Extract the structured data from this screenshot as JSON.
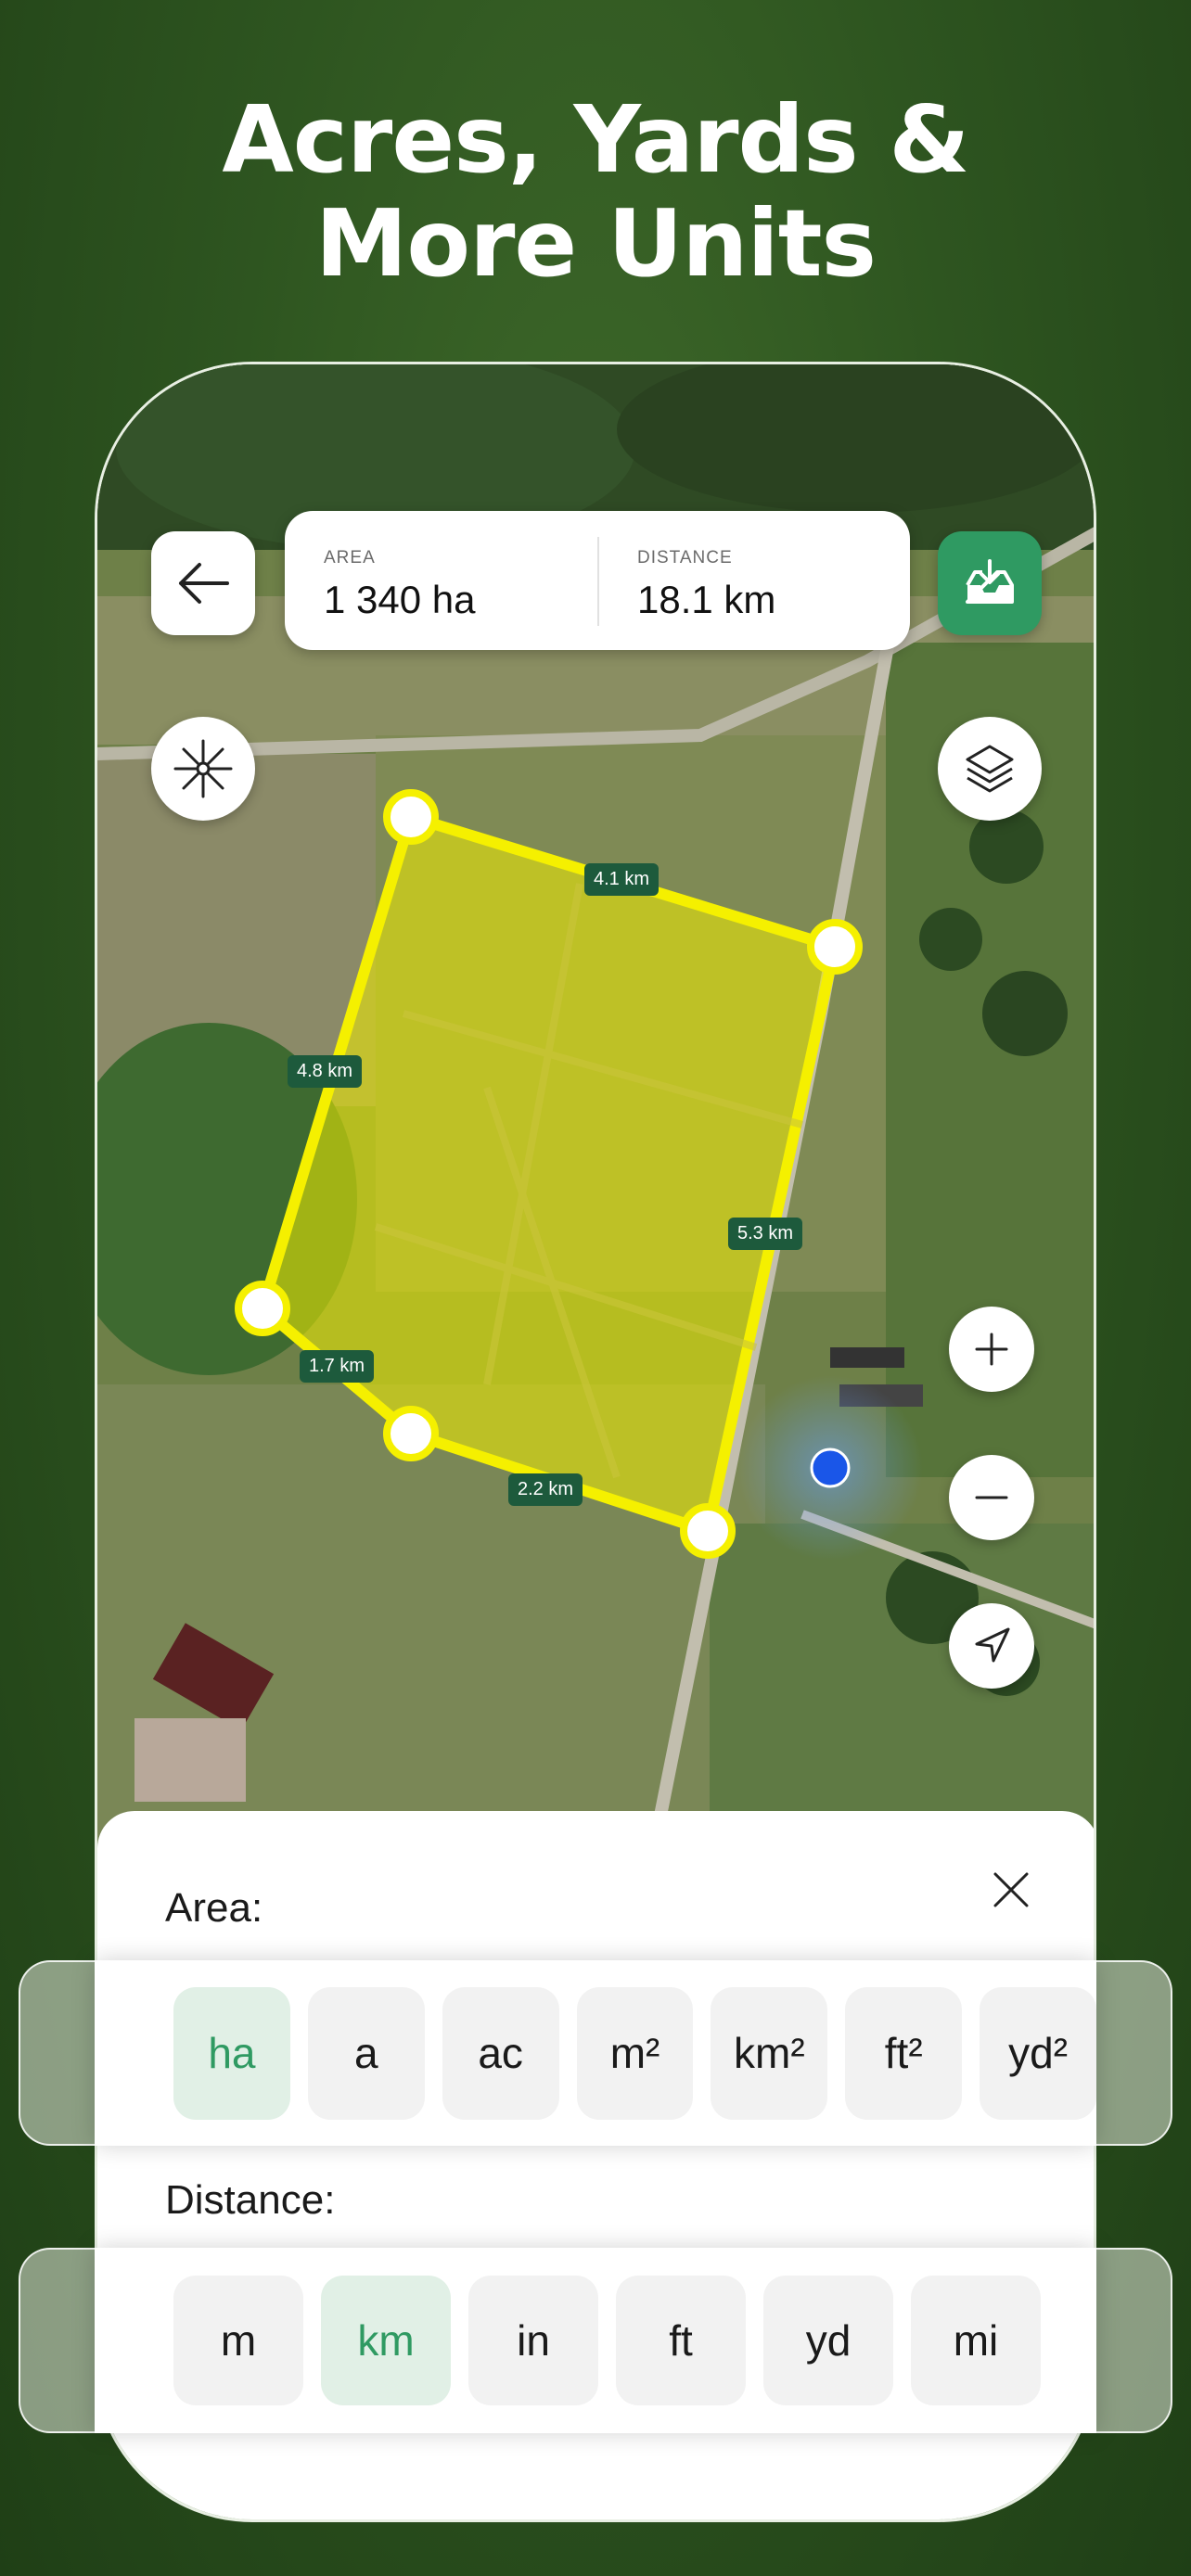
{
  "headline": {
    "line1": "Acres, Yards &",
    "line2": "More Units"
  },
  "stats": {
    "area_label": "AREA",
    "area_value": "1 340 ha",
    "distance_label": "DISTANCE",
    "distance_value": "18.1 km"
  },
  "segments": [
    "4.1 km",
    "4.8 km",
    "5.3 km",
    "1.7 km",
    "2.2 km"
  ],
  "sheet": {
    "area_title": "Area:",
    "distance_title": "Distance:",
    "area_units": [
      "ha",
      "a",
      "ac",
      "m²",
      "km²",
      "ft²",
      "yd²"
    ],
    "area_selected": "ha",
    "distance_units": [
      "m",
      "km",
      "in",
      "ft",
      "yd",
      "mi"
    ],
    "distance_selected": "km"
  },
  "icons": {
    "back": "arrow-left-icon",
    "save": "download-tray-icon",
    "compass": "compass-icon",
    "layers": "layers-icon",
    "zoom_in": "plus-icon",
    "zoom_out": "minus-icon",
    "locate": "navigation-arrow-icon",
    "close": "close-icon"
  },
  "colors": {
    "accent": "#2f9a62",
    "polygon": "#f5f000",
    "label_bg": "#1d5a3c",
    "location_dot": "#1a56e8"
  }
}
